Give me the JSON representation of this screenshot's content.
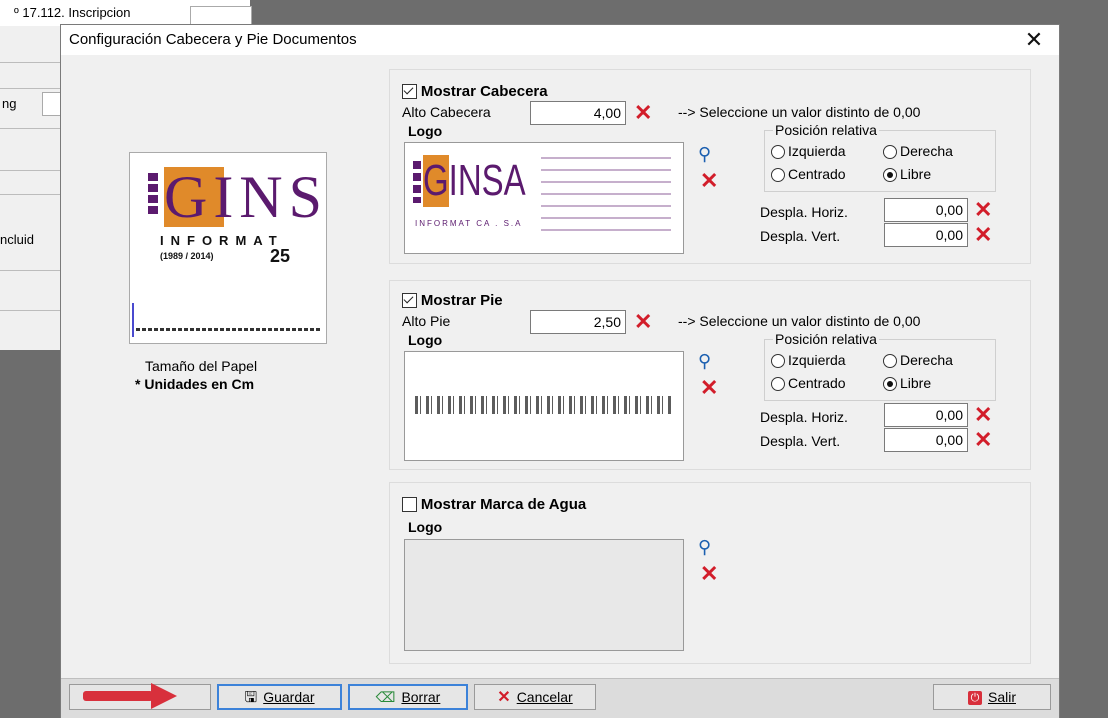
{
  "background": {
    "title": "º 17.112. Inscripcion",
    "label_ng": "ng",
    "label_incluid": "ncluid"
  },
  "dialog": {
    "title": "Configuración Cabecera y Pie Documentos",
    "close_glyph": "✕",
    "paper": {
      "label": "Tamaño del Papel",
      "units": "* Unidades en Cm",
      "logo_text_a": "GINSA",
      "logo_text_b": "INFORMAT",
      "logo_text_c": "(1989 / 2014)",
      "logo_text_d": "25"
    },
    "header": {
      "checkbox_label": "Mostrar Cabecera",
      "checked": true,
      "height_label": "Alto Cabecera",
      "height_value": "4,00",
      "hint": "--> Seleccione un valor distinto de 0,00",
      "logo_label": "Logo",
      "logo_text": "GINSA",
      "logo_sub": "INFORMAT CA . S.A",
      "position_legend": "Posición relativa",
      "opt_izquierda": "Izquierda",
      "opt_derecha": "Derecha",
      "opt_centrado": "Centrado",
      "opt_libre": "Libre",
      "selected": "Libre",
      "horiz_label": "Despla. Horiz.",
      "horiz_value": "0,00",
      "vert_label": "Despla. Vert.",
      "vert_value": "0,00"
    },
    "footer": {
      "checkbox_label": "Mostrar Pie",
      "checked": true,
      "height_label": "Alto Pie",
      "height_value": "2,50",
      "hint": "--> Seleccione un valor distinto de 0,00",
      "logo_label": "Logo",
      "position_legend": "Posición relativa",
      "opt_izquierda": "Izquierda",
      "opt_derecha": "Derecha",
      "opt_centrado": "Centrado",
      "opt_libre": "Libre",
      "selected": "Libre",
      "horiz_label": "Despla. Horiz.",
      "horiz_value": "0,00",
      "vert_label": "Despla. Vert.",
      "vert_value": "0,00"
    },
    "watermark": {
      "checkbox_label": "Mostrar Marca de Agua",
      "checked": false,
      "logo_label": "Logo"
    },
    "buttons": {
      "guardar": "Guardar",
      "borrar": "Borrar",
      "cancelar": "Cancelar",
      "salir": "Salir"
    },
    "colors": {
      "accent_red": "#d21d2a",
      "logo_purple": "#5b1a6e",
      "logo_orange": "#e08a2a",
      "focus_blue": "#3c82d9"
    }
  }
}
